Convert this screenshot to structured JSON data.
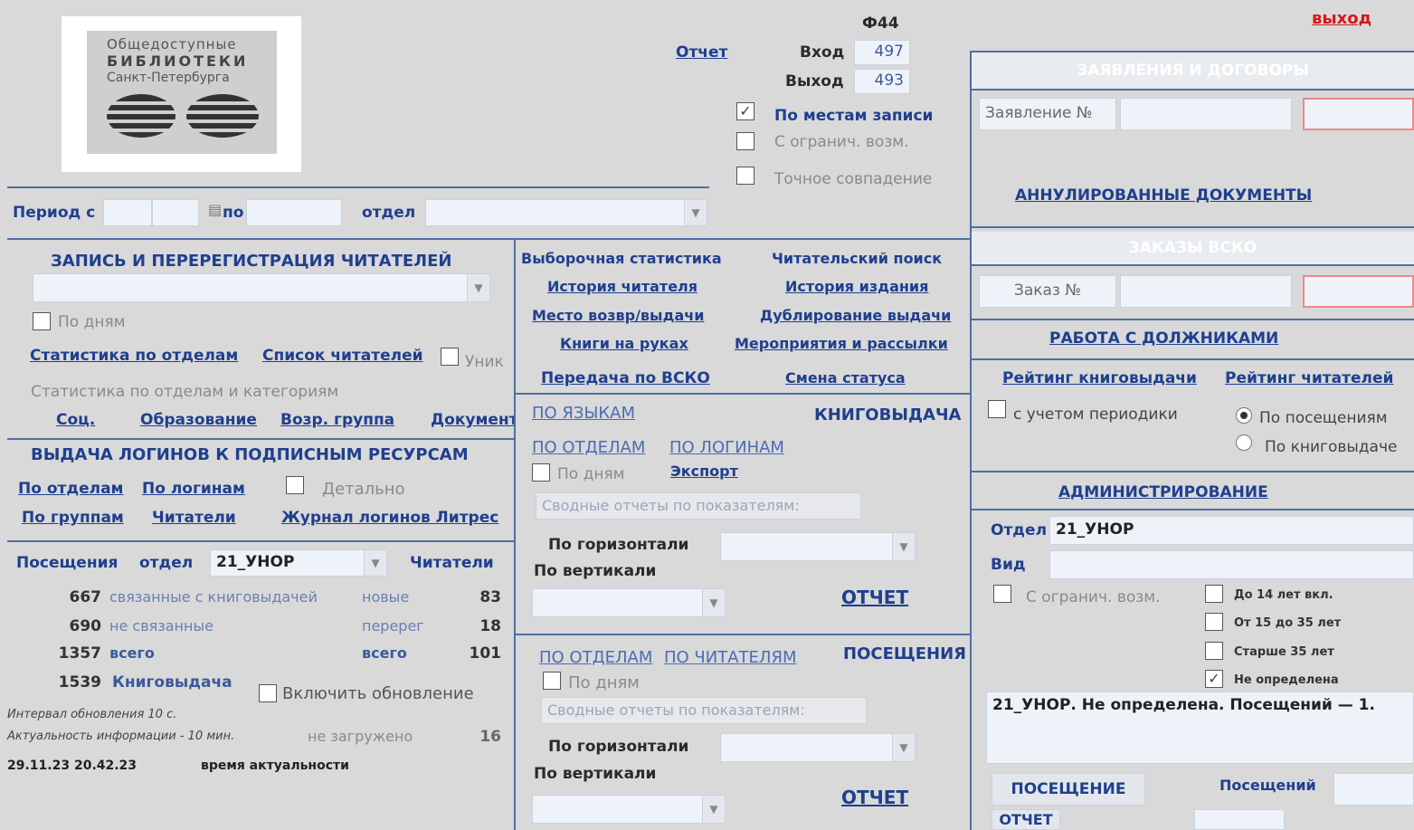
{
  "logo": {
    "line1": "Общедоступные",
    "line2": "БИБЛИОТЕКИ",
    "line3": "Санкт-Петербурга"
  },
  "top": {
    "form_code": "Ф44",
    "exit": "выход",
    "report": "Отчет",
    "in_label": "Вход",
    "in_value": "497",
    "out_label": "Выход",
    "out_value": "493",
    "by_place": "По местам записи",
    "limited": "С огранич. возм.",
    "exact": "Точное совпадение"
  },
  "period": {
    "from_label": "Период с",
    "to_label": "по",
    "dept_label": "отдел"
  },
  "reg": {
    "title": "ЗАПИСЬ И ПЕРЕРЕГИСТРАЦИЯ ЧИТАТЕЛЕЙ",
    "by_days": "По дням",
    "stat_dept": "Статистика по отделам",
    "reader_list": "Список читателей",
    "unique": "Уник",
    "stat_dept_cat": "Статистика по отделам и категориям",
    "soc": "Соц.",
    "edu": "Образование",
    "age": "Возр. группа",
    "doc": "Документ"
  },
  "logins": {
    "title": "ВЫДАЧА ЛОГИНОВ К ПОДПИСНЫМ РЕСУРСАМ",
    "by_dept": "По отделам",
    "by_login": "По логинам",
    "detailed": "Детально",
    "by_group": "По группам",
    "readers": "Читатели",
    "litres": "Журнал логинов Литрес"
  },
  "visits": {
    "label": "Посещения",
    "dept_label": "отдел",
    "dept_value": "21_УНОР",
    "readers_label": "Читатели",
    "rows": [
      {
        "n": "667",
        "text": "связанные с книговыдачей",
        "k": "новые",
        "v": "83"
      },
      {
        "n": "690",
        "text": "не связанные",
        "k": "перерег",
        "v": "18"
      },
      {
        "n": "1357",
        "text": "всего",
        "k": "всего",
        "v": "101"
      }
    ],
    "issue_num": "1539",
    "issue_label": "Книговыдача",
    "auto_update": "Включить обновление",
    "interval": "Интервал обновления 10 с.",
    "actuality": "Актуальность информации - 10 мин.",
    "not_loaded": "не загружено",
    "not_loaded_val": "16",
    "datetime": "29.11.23 20.42.23",
    "actual_time": "время актуальности"
  },
  "mid": {
    "sample_stat": "Выборочная статистика",
    "reader_search": "Читательский поиск",
    "reader_hist": "История читателя",
    "edition_hist": "История издания",
    "place": "Место возвр/выдачи",
    "dup": "Дублирование выдачи",
    "on_hands": "Книги на руках",
    "events": "Мероприятия и рассылки",
    "vsko": "Передача по ВСКО",
    "status": "Смена статуса"
  },
  "issue": {
    "by_lang": "ПО ЯЗЫКАМ",
    "title": "КНИГОВЫДАЧА",
    "by_dept": "ПО ОТДЕЛАМ",
    "by_login": "ПО ЛОГИНАМ",
    "by_days": "По дням",
    "export": "Экспорт",
    "summary": "Сводные отчеты по показателям:",
    "horiz": "По горизонтали",
    "vert": "По вертикали",
    "report": "ОТЧЕТ"
  },
  "visit2": {
    "by_dept": "ПО ОТДЕЛАМ",
    "by_readers": "ПО ЧИТАТЕЛЯМ",
    "title": "ПОСЕЩЕНИЯ",
    "by_days": "По дням",
    "summary": "Сводные отчеты по показателям:",
    "horiz": "По горизонтали",
    "vert": "По вертикали",
    "report": "ОТЧЕТ"
  },
  "right": {
    "apps_title": "ЗАЯВЛЕНИЯ И ДОГОВОРЫ",
    "app_no": "Заявление №",
    "cancelled": "АННУЛИРОВАННЫЕ ДОКУМЕНТЫ",
    "orders_title": "ЗАКАЗЫ ВСКО",
    "order_no": "Заказ №",
    "debtors": "РАБОТА С ДОЛЖНИКАМИ",
    "rating_issue": "Рейтинг книговыдачи",
    "rating_readers": "Рейтинг читателей",
    "periodic": "с учетом периодики",
    "by_visits": "По посещениям",
    "by_issue": "По книговыдаче",
    "admin": "АДМИНИСТРИРОВАНИЕ",
    "dept_label": "Отдел",
    "dept_value": "21_УНОР",
    "kind_label": "Вид",
    "limited": "С огранич. возм.",
    "age1": "До 14 лет вкл.",
    "age2": "От 15 до 35 лет",
    "age3": "Старше 35 лет",
    "age4": "Не определена",
    "summary": "21_УНОР.  Не определена.  Посещений — 1.",
    "visit_btn": "ПОСЕЩЕНИЕ",
    "visits_label": "Посещений",
    "report_btn": "ОТЧЕТ"
  },
  "colors": {
    "accent": "#1f3f8f",
    "exit": "#d11a1a",
    "border": "#4f6f9f"
  }
}
